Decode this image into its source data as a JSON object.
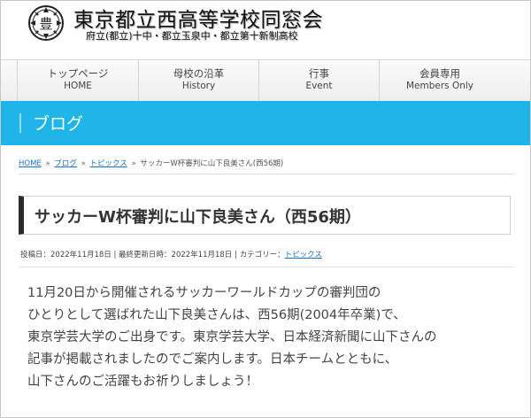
{
  "site": {
    "title": "東京都立西高等学校同窓会",
    "subtitle": "府立(都立)十中・都立玉泉中・都立第十新制高校",
    "logo_label": "豊"
  },
  "nav": {
    "items": [
      {
        "label_jp": "トップページ",
        "label_en": "HOME"
      },
      {
        "label_jp": "母校の沿革",
        "label_en": "History"
      },
      {
        "label_jp": "行事",
        "label_en": "Event"
      },
      {
        "label_jp": "会員専用",
        "label_en": "Members Only"
      }
    ]
  },
  "banner": {
    "title": "ブログ"
  },
  "breadcrumb": {
    "items": [
      "HOME",
      "ブログ",
      "トピックス"
    ],
    "current": "サッカーW杯審判に山下良美さん(西56期)",
    "separator": "»"
  },
  "post": {
    "title": "サッカーW杯審判に山下良美さん（西56期）",
    "meta": {
      "posted_label": "投稿日：2022年11月18日",
      "divider": "|",
      "updated_label": "最終更新日時：2022年11月18日",
      "category_label": "カテゴリー：",
      "category": "トピックス"
    },
    "body": [
      "11月20日から開催されるサッカーワールドカップの審判団の",
      "ひとりとして選ばれた山下良美さんは、西56期(2004年卒業)で、",
      "東京学芸大学のご出身です。東京学芸大学、日本経済新聞に山下さんの",
      "記事が掲載されましたのでご案内します。日本チームとともに、",
      "山下さんのご活躍もお祈りしましょう！"
    ]
  },
  "colors": {
    "banner": "#1fb5e9",
    "link": "#1a6fc7",
    "title_accent": "#2a2a2a"
  }
}
